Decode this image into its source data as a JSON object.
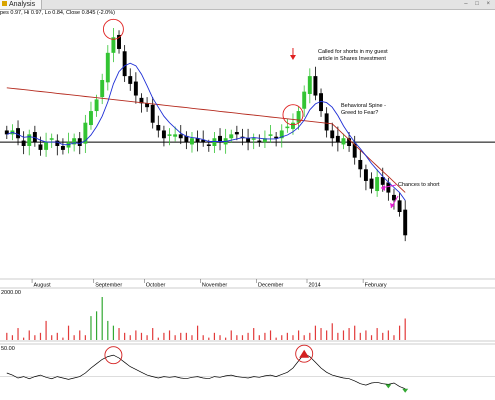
{
  "window": {
    "tab_label": "Analysis",
    "window_buttons": "– □ ×"
  },
  "header": {
    "ohlc_text": "pes 0.97, Hi 0.97, Lo 0.84, Close 0.845 (-2.0%)"
  },
  "chart_data": [
    {
      "type": "candlestick",
      "title": "",
      "months": [
        "August",
        "September",
        "October",
        "November",
        "December",
        "2014",
        "February"
      ],
      "month_positions_bar_index": [
        5,
        16,
        25,
        35,
        45,
        54,
        64
      ],
      "reference_line_close": 0.97,
      "series": [
        {
          "name": "",
          "kind": "ohlc",
          "close": [
            0.99,
            1.0,
            0.98,
            0.96,
            0.99,
            0.97,
            0.95,
            0.97,
            0.98,
            0.96,
            0.95,
            0.97,
            0.98,
            0.96,
            1.02,
            1.05,
            1.08,
            1.13,
            1.2,
            1.24,
            1.21,
            1.14,
            1.12,
            1.09,
            1.07,
            1.06,
            1.02,
            1.0,
            0.98,
            0.99,
            0.99,
            0.98,
            0.97,
            0.98,
            0.97,
            0.97,
            0.96,
            0.98,
            0.97,
            0.98,
            0.99,
            0.99,
            0.98,
            0.97,
            0.98,
            0.97,
            0.98,
            0.99,
            0.98,
            1.0,
            1.01,
            1.02,
            1.05,
            1.1,
            1.14,
            1.09,
            1.05,
            1.0,
            0.98,
            0.97,
            0.98,
            0.96,
            0.93,
            0.9,
            0.87,
            0.85,
            0.88,
            0.86,
            0.84,
            0.82,
            0.79,
            0.73
          ]
        },
        {
          "name": "",
          "kind": "moving-average-short",
          "color": "#1f2fd6"
        },
        {
          "name": "",
          "kind": "moving-average-long",
          "color": "#b52a1e"
        }
      ],
      "annotations": [
        {
          "text": "Called for shorts in my guest article in Shares Investment",
          "bar_index": 52
        },
        {
          "text": "Behavioral Spine - Greed to Fear?",
          "bar_index": 55
        },
        {
          "text": "Chances to short",
          "bar_index": 68
        }
      ],
      "highlight_circles_bar_index": [
        19,
        51
      ],
      "colors": {
        "up": "#33c433",
        "down": "#000000",
        "arrow_red": "#e02020",
        "arrow_magenta": "#e020d0"
      }
    },
    {
      "type": "bar",
      "title": "",
      "axis_label": "2000.00",
      "values": [
        3,
        2,
        5,
        1,
        4,
        2,
        3,
        8,
        2,
        3,
        1,
        6,
        2,
        4,
        2,
        10,
        12,
        18,
        8,
        6,
        5,
        3,
        2,
        4,
        3,
        2,
        5,
        1,
        3,
        4,
        2,
        3,
        3,
        2,
        6,
        2,
        1,
        3,
        2,
        1,
        4,
        2,
        2,
        3,
        5,
        2,
        3,
        4,
        1,
        2,
        3,
        2,
        4,
        2,
        3,
        6,
        5,
        4,
        7,
        3,
        4,
        5,
        6,
        3,
        4,
        2,
        5,
        3,
        4,
        2,
        6,
        9
      ],
      "color": "#e23a3a",
      "accent_color": "#33a833"
    },
    {
      "type": "line",
      "title": "",
      "axis_label": "50.00",
      "values": [
        55,
        52,
        48,
        50,
        47,
        50,
        52,
        49,
        47,
        50,
        48,
        46,
        48,
        50,
        55,
        62,
        68,
        74,
        78,
        80,
        76,
        70,
        64,
        60,
        56,
        52,
        50,
        48,
        50,
        49,
        50,
        48,
        47,
        49,
        50,
        48,
        47,
        50,
        49,
        51,
        52,
        50,
        49,
        48,
        50,
        49,
        51,
        52,
        50,
        53,
        56,
        62,
        72,
        82,
        78,
        70,
        62,
        56,
        52,
        50,
        48,
        47,
        44,
        40,
        38,
        41,
        42,
        40,
        39,
        41,
        36,
        33
      ],
      "color": "#000000",
      "highlight_color": "#d42020"
    }
  ]
}
